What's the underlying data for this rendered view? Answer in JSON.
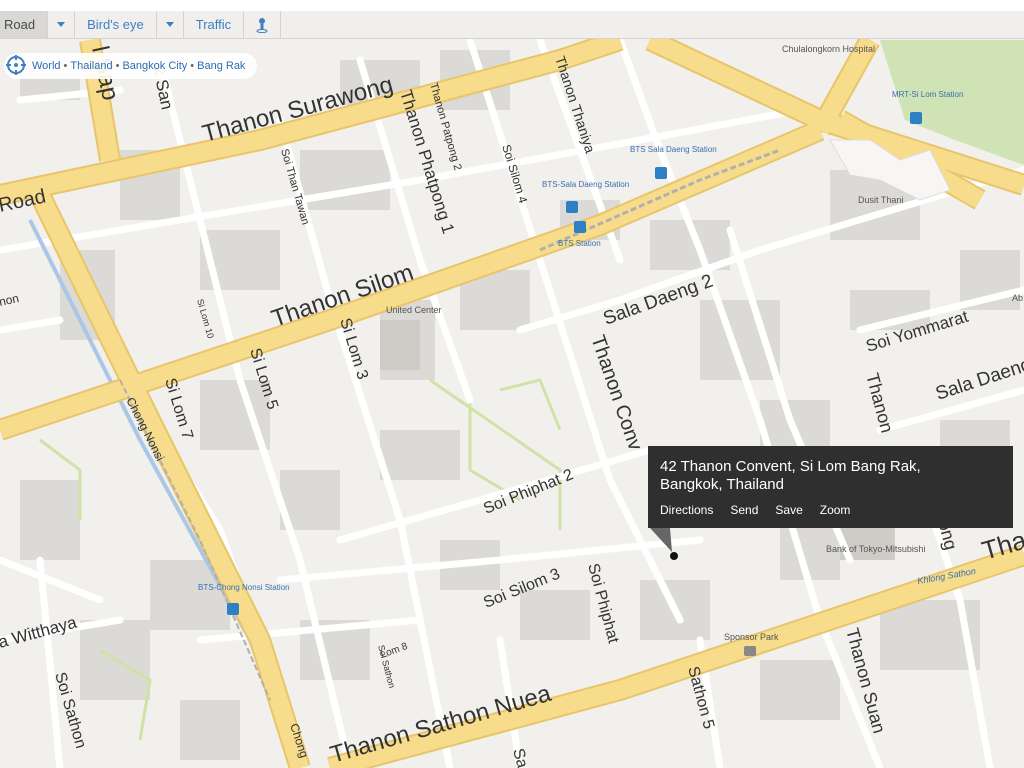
{
  "toolbar": {
    "road": "Road",
    "birds_eye": "Bird's eye",
    "traffic": "Traffic"
  },
  "breadcrumb": {
    "items": [
      "World",
      "Thailand",
      "Bangkok City",
      "Bang Rak"
    ],
    "separator": "•"
  },
  "popup": {
    "line1": "42 Thanon Convent, Si Lom Bang Rak,",
    "line2": "Bangkok, Thailand",
    "actions": [
      "Directions",
      "Send",
      "Save",
      "Zoom"
    ]
  },
  "streets": {
    "surawong": "Thanon Surawong",
    "silom": "Thanon Silom",
    "sathon_nuea": "Thanon Sathon Nuea",
    "sala_daeng_2": "Sala Daeng 2",
    "soi_yommarat": "Soi Yommarat",
    "sala_daeng": "Sala Daeng",
    "thanon_convent": "Thanon Conv",
    "thanon_phatpong_1": "Thanon Phatpong 1",
    "thanon_patpong_2": "Thanon Patpong 2",
    "soi_silom_4": "Soi Silom 4",
    "thanon_thaniya": "Thanon Thaniya",
    "soi_than_tawan": "Soi Than Tawan",
    "si_lom_3": "Si Lom 3",
    "si_lom_5": "Si Lom 5",
    "si_lom_7": "Si Lom 7",
    "si_lom_10": "Si Lom 10",
    "soi_phiphat_2": "Soi Phiphat 2",
    "soi_silom_3": "Soi Silom 3",
    "soi_phiphat": "Soi Phiphat",
    "sathon_5": "Sathon 5",
    "thanon_suan": "Thanon Suan",
    "chong_nonsi": "Chong Nonsi",
    "witthaya": "a Witthaya",
    "soi_sathon": "Soi Sathon",
    "sap": "l Sap",
    "road": "Road",
    "k_san": "k San",
    "thanon_right": "Thanon",
    "tha": "Tha",
    "ong": "ong",
    "nan": "non",
    "lom_8": "Lom 8",
    "soi_sathon_small": "Soi Sathon",
    "sa": "Sa",
    "chong": "Chong",
    "khlong_sathon": "Khlong Sathon"
  },
  "pois": {
    "chulalongkorn": "Chulalongkorn Hospital",
    "mrt_silom": "MRT-Si Lom Station",
    "dusit_thani": "Dusit Thani",
    "bts_sala_daeng_1": "BTS Sala Daeng Station",
    "bts_sala_daeng_2": "BTS-Sala Daeng Station",
    "bts_station": "BTS Station",
    "united_center": "United Center",
    "bank_of_tokyo": "Bank of Tokyo-Mitsubishi",
    "sponsor_park": "Sponsor Park",
    "bts_chong_nonsi": "BTS-Chong Nonsi Station",
    "ab": "Ab"
  },
  "colors": {
    "major_road": "#f7dc8c",
    "major_road_edge": "#e8c56b",
    "minor_road": "#ffffff",
    "block": "#dcdad6",
    "ground": "#f2f0ec",
    "park": "#cfe3b4",
    "path": "#cfe3a8",
    "popup_bg": "#2f2f2f",
    "link": "#3d7fc2"
  }
}
